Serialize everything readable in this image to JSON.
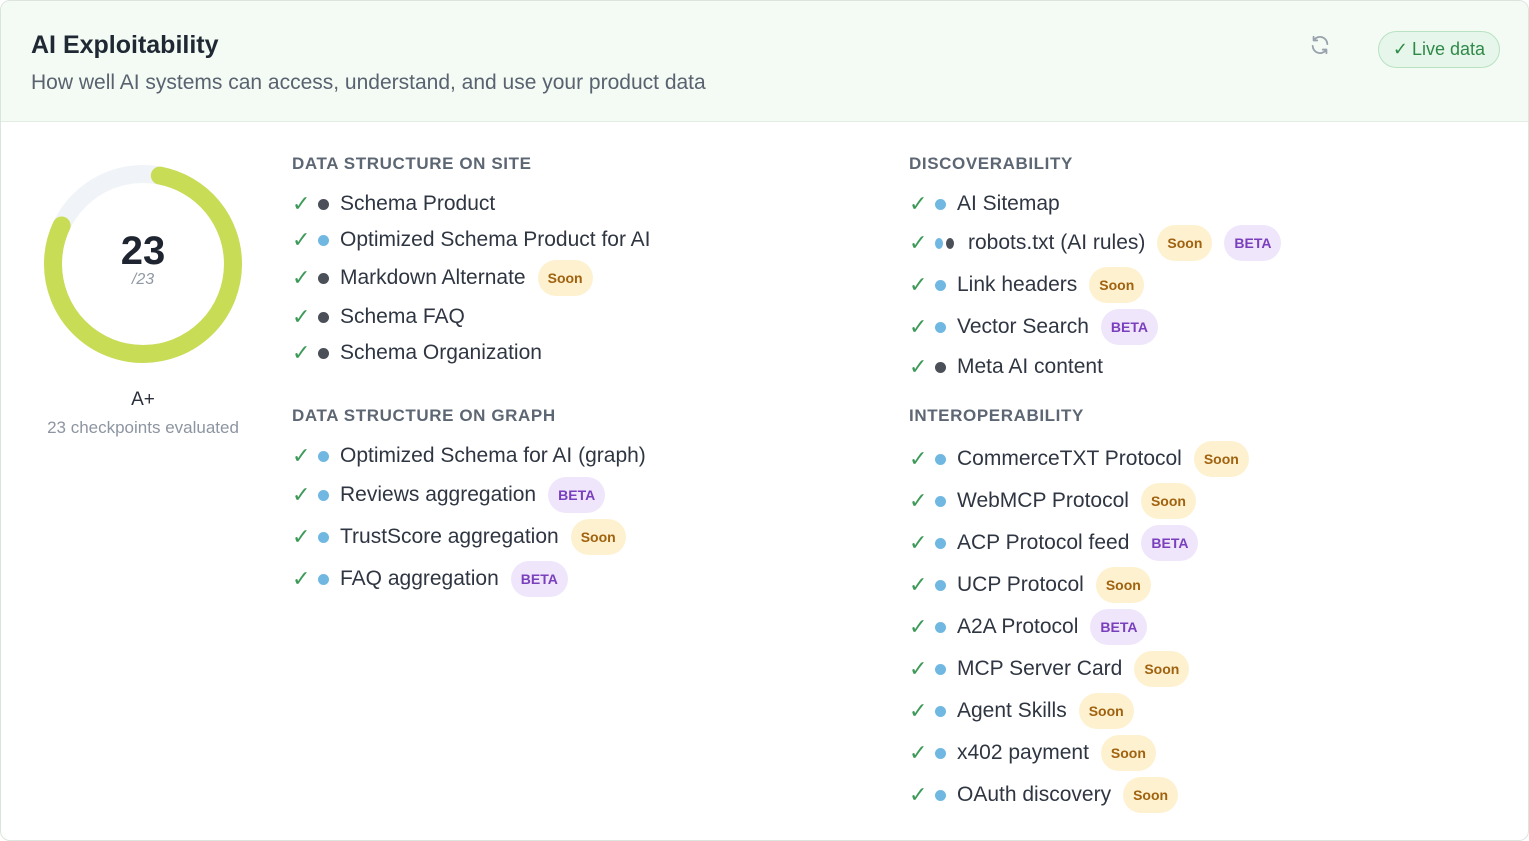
{
  "header": {
    "title": "AI Exploitability",
    "subtitle": "How well AI systems can access, understand, and use your product data",
    "live_label": "Live data",
    "live_check": "✓"
  },
  "score": {
    "value": "23",
    "denominator": "/23",
    "fraction": 1.0,
    "grade": "A+",
    "evaluated": "23 checkpoints evaluated"
  },
  "colors": {
    "accent_green": "#3d9a58",
    "gauge": "#c9dc55",
    "soon_bg": "#fdf1cf",
    "beta_bg": "#efe6fb"
  },
  "sections": {
    "site": {
      "title": "DATA STRUCTURE ON SITE",
      "items": [
        {
          "label": "Schema Product",
          "dots": [
            "dark"
          ],
          "badges": []
        },
        {
          "label": "Optimized Schema Product for AI",
          "dots": [
            "blue"
          ],
          "badges": []
        },
        {
          "label": "Markdown Alternate",
          "dots": [
            "dark"
          ],
          "badges": [
            "Soon"
          ]
        },
        {
          "label": "Schema FAQ",
          "dots": [
            "dark"
          ],
          "badges": []
        },
        {
          "label": "Schema Organization",
          "dots": [
            "dark"
          ],
          "badges": []
        }
      ]
    },
    "graph": {
      "title": "DATA STRUCTURE ON GRAPH",
      "items": [
        {
          "label": "Optimized Schema for AI (graph)",
          "dots": [
            "blue"
          ],
          "badges": []
        },
        {
          "label": "Reviews aggregation",
          "dots": [
            "blue"
          ],
          "badges": [
            "BETA"
          ]
        },
        {
          "label": "TrustScore aggregation",
          "dots": [
            "blue"
          ],
          "badges": [
            "Soon"
          ]
        },
        {
          "label": "FAQ aggregation",
          "dots": [
            "blue"
          ],
          "badges": [
            "BETA"
          ]
        }
      ]
    },
    "discoverability": {
      "title": "DISCOVERABILITY",
      "items": [
        {
          "label": "AI Sitemap",
          "dots": [
            "blue"
          ],
          "badges": []
        },
        {
          "label": "robots.txt (AI rules)",
          "dots": [
            "blue",
            "dark"
          ],
          "badges": [
            "Soon",
            "BETA"
          ]
        },
        {
          "label": "Link headers",
          "dots": [
            "blue"
          ],
          "badges": [
            "Soon"
          ]
        },
        {
          "label": "Vector Search",
          "dots": [
            "blue"
          ],
          "badges": [
            "BETA"
          ]
        },
        {
          "label": "Meta AI content",
          "dots": [
            "dark"
          ],
          "badges": []
        }
      ]
    },
    "interop": {
      "title": "INTEROPERABILITY",
      "items": [
        {
          "label": "CommerceTXT Protocol",
          "dots": [
            "blue"
          ],
          "badges": [
            "Soon"
          ]
        },
        {
          "label": "WebMCP Protocol",
          "dots": [
            "blue"
          ],
          "badges": [
            "Soon"
          ]
        },
        {
          "label": "ACP Protocol feed",
          "dots": [
            "blue"
          ],
          "badges": [
            "BETA"
          ]
        },
        {
          "label": "UCP Protocol",
          "dots": [
            "blue"
          ],
          "badges": [
            "Soon"
          ]
        },
        {
          "label": "A2A Protocol",
          "dots": [
            "blue"
          ],
          "badges": [
            "BETA"
          ]
        },
        {
          "label": "MCP Server Card",
          "dots": [
            "blue"
          ],
          "badges": [
            "Soon"
          ]
        },
        {
          "label": "Agent Skills",
          "dots": [
            "blue"
          ],
          "badges": [
            "Soon"
          ]
        },
        {
          "label": "x402 payment",
          "dots": [
            "blue"
          ],
          "badges": [
            "Soon"
          ]
        },
        {
          "label": "OAuth discovery",
          "dots": [
            "blue"
          ],
          "badges": [
            "Soon"
          ]
        }
      ]
    }
  }
}
